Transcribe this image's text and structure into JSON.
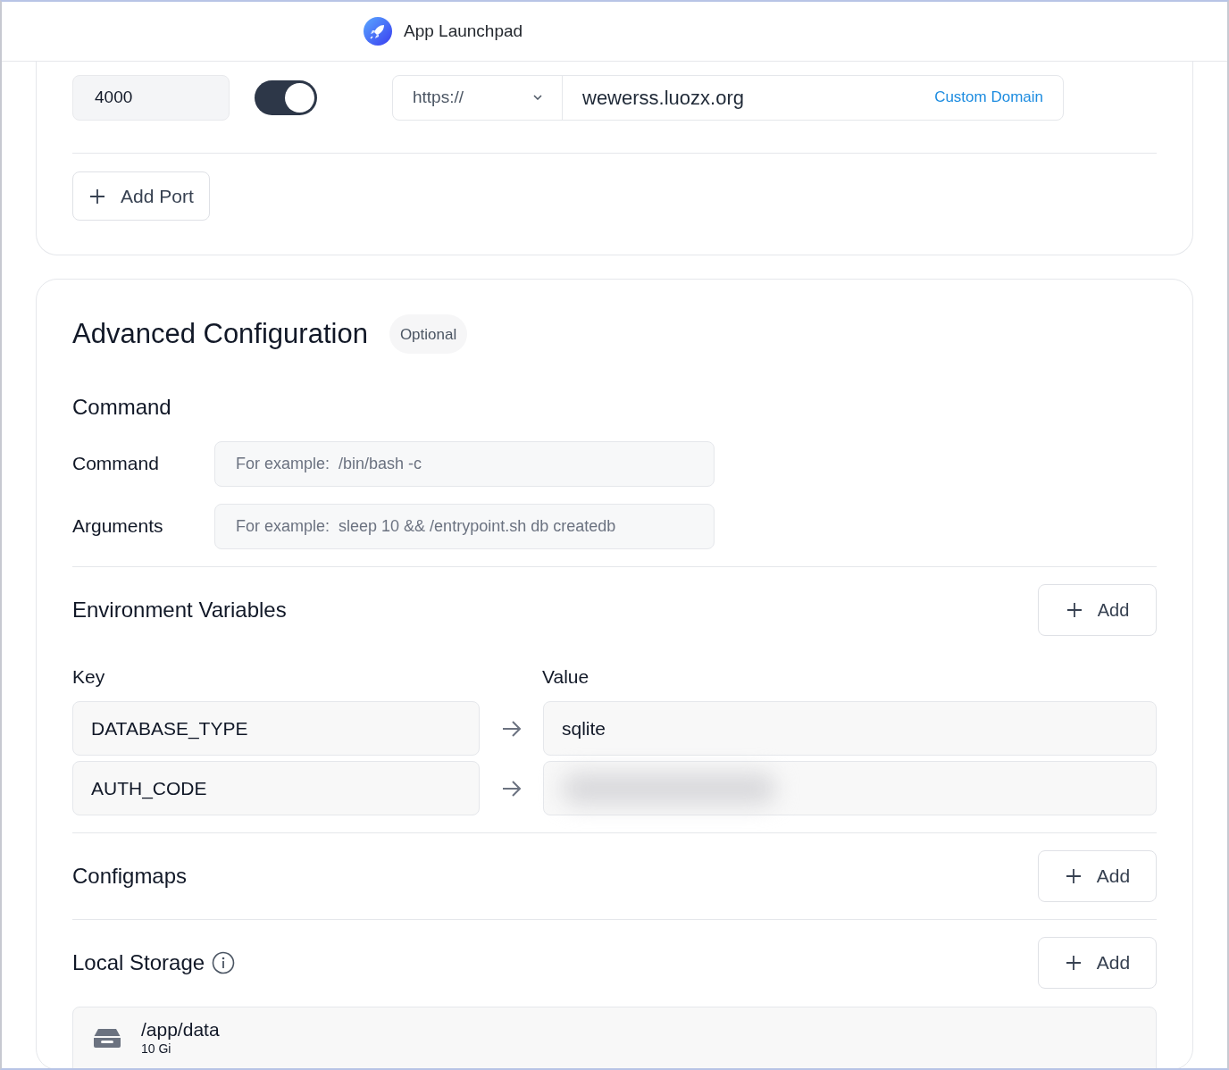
{
  "header": {
    "title": "App Launchpad"
  },
  "port": {
    "value": "4000",
    "public_access_on": true,
    "protocol": "https://",
    "domain": "wewerss.luozx.org",
    "custom_domain_link": "Custom Domain"
  },
  "add_port_button": "Add Port",
  "advanced": {
    "title": "Advanced Configuration",
    "badge": "Optional",
    "command_section": {
      "title": "Command",
      "fields": [
        {
          "label": "Command",
          "placeholder": "For example:  /bin/bash -c"
        },
        {
          "label": "Arguments",
          "placeholder": "For example:  sleep 10 && /entrypoint.sh db createdb"
        }
      ]
    },
    "env": {
      "title": "Environment Variables",
      "add_button": "Add",
      "key_header": "Key",
      "value_header": "Value",
      "rows": [
        {
          "key": "DATABASE_TYPE",
          "value": "sqlite",
          "masked": false
        },
        {
          "key": "AUTH_CODE",
          "masked": true
        }
      ]
    },
    "configmaps": {
      "title": "Configmaps",
      "add_button": "Add"
    },
    "local_storage": {
      "title": "Local Storage",
      "add_button": "Add",
      "items": [
        {
          "path": "/app/data",
          "size": "10 Gi"
        }
      ]
    }
  }
}
